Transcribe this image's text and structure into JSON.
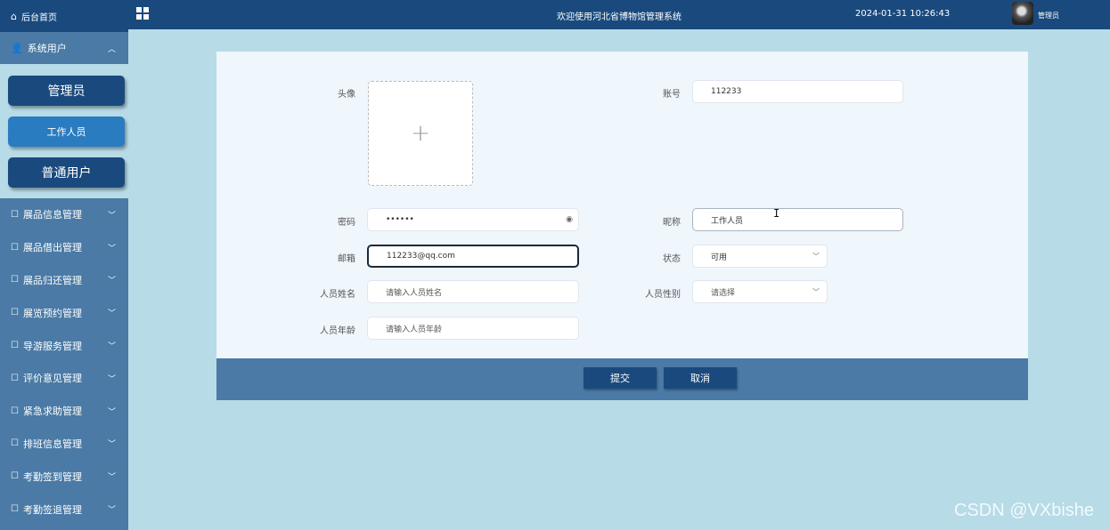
{
  "sidebar": {
    "home_label": "后台首页",
    "group_label": "系统用户",
    "sub_items": [
      "管理员",
      "工作人员",
      "普通用户"
    ],
    "menu_items": [
      "展品信息管理",
      "展品借出管理",
      "展品归还管理",
      "展览预约管理",
      "导游服务管理",
      "评价意见管理",
      "紧急求助管理",
      "排班信息管理",
      "考勤签到管理",
      "考勤签退管理"
    ]
  },
  "topbar": {
    "welcome": "欢迎使用河北省博物馆管理系统",
    "datetime": "2024-01-31 10:26:43",
    "user": "管理员"
  },
  "form": {
    "avatar_label": "头像",
    "account_label": "账号",
    "account_value": "112233",
    "password_label": "密码",
    "password_value": "••••••",
    "nickname_label": "昵称",
    "nickname_value": "工作人员",
    "email_label": "邮箱",
    "email_value": "112233@qq.com",
    "status_label": "状态",
    "status_value": "可用",
    "name_label": "人员姓名",
    "name_placeholder": "请输入人员姓名",
    "gender_label": "人员性别",
    "gender_placeholder": "请选择",
    "age_label": "人员年龄",
    "age_placeholder": "请输入人员年龄"
  },
  "actions": {
    "submit": "提交",
    "cancel": "取消"
  },
  "watermark": "CSDN @VXbishe",
  "colors": {
    "primary": "#1a4a7d",
    "sidebar": "#4a7aa5",
    "background": "#b7dbe7",
    "active_sub": "#2a7cc0"
  }
}
